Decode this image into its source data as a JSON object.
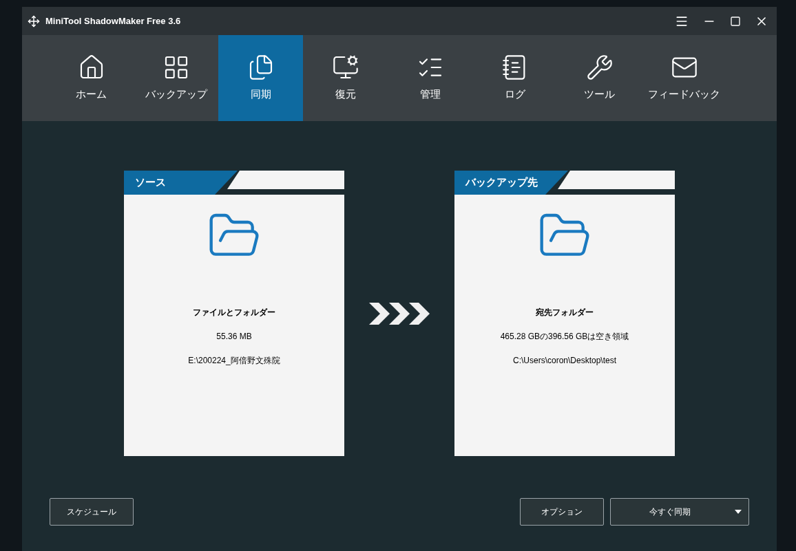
{
  "window": {
    "title": "MiniTool ShadowMaker Free 3.6"
  },
  "tabs": [
    {
      "label": "ホーム",
      "kind": "home",
      "selected": false
    },
    {
      "label": "バックアップ",
      "kind": "backup",
      "selected": false
    },
    {
      "label": "同期",
      "kind": "sync",
      "selected": true
    },
    {
      "label": "復元",
      "kind": "restore",
      "selected": false
    },
    {
      "label": "管理",
      "kind": "manage",
      "selected": false
    },
    {
      "label": "ログ",
      "kind": "log",
      "selected": false
    },
    {
      "label": "ツール",
      "kind": "tools",
      "selected": false
    },
    {
      "label": "フィードバック",
      "kind": "feedback",
      "selected": false
    }
  ],
  "cards": [
    {
      "header": "ソース",
      "title": "ファイルとフォルダー",
      "lines": [
        "55.36 MB",
        "E:\\200224_阿倍野文殊院"
      ]
    },
    {
      "header": "バックアップ先",
      "title": "宛先フォルダー",
      "lines": [
        "465.28 GBの396.56 GBは空き領域",
        "C:\\Users\\coron\\Desktop\\test"
      ]
    }
  ],
  "buttons": {
    "schedule": "スケジュール",
    "options": "オプション",
    "sync_now": "今すぐ同期"
  }
}
